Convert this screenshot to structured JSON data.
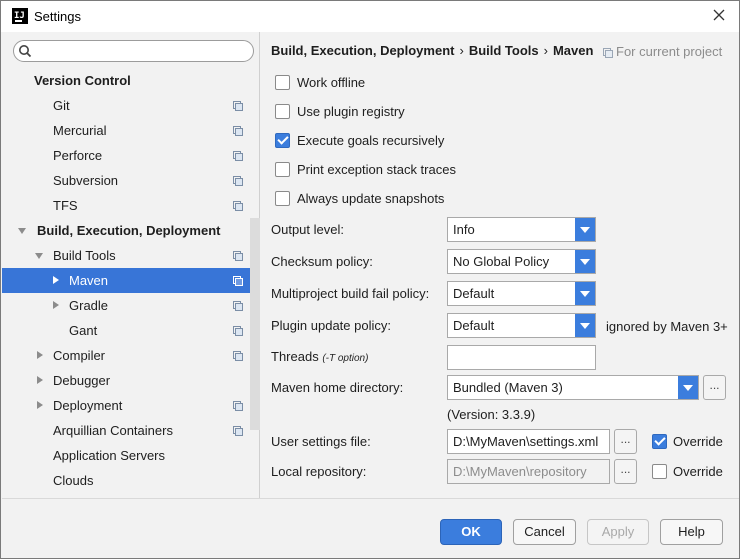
{
  "window": {
    "title": "Settings",
    "app_icon_text": "IJ"
  },
  "search": {
    "placeholder": "",
    "value": ""
  },
  "sidebar": {
    "items": [
      {
        "label": "Version Control"
      },
      {
        "label": "Git"
      },
      {
        "label": "Mercurial"
      },
      {
        "label": "Perforce"
      },
      {
        "label": "Subversion"
      },
      {
        "label": "TFS"
      },
      {
        "label": "Build, Execution, Deployment"
      },
      {
        "label": "Build Tools"
      },
      {
        "label": "Maven"
      },
      {
        "label": "Gradle"
      },
      {
        "label": "Gant"
      },
      {
        "label": "Compiler"
      },
      {
        "label": "Debugger"
      },
      {
        "label": "Deployment"
      },
      {
        "label": "Arquillian Containers"
      },
      {
        "label": "Application Servers"
      },
      {
        "label": "Clouds"
      }
    ],
    "selected": "Maven"
  },
  "breadcrumb": {
    "parts": [
      "Build, Execution, Deployment",
      "Build Tools",
      "Maven"
    ],
    "separator": "›",
    "scope_label": "For current project"
  },
  "checkboxes": [
    {
      "label": "Work offline",
      "checked": false
    },
    {
      "label": "Use plugin registry",
      "checked": false
    },
    {
      "label": "Execute goals recursively",
      "checked": true
    },
    {
      "label": "Print exception stack traces",
      "checked": false
    },
    {
      "label": "Always update snapshots",
      "checked": false
    }
  ],
  "form": {
    "output_level": {
      "label": "Output level:",
      "value": "Info"
    },
    "checksum_policy": {
      "label": "Checksum policy:",
      "value": "No Global Policy"
    },
    "multiproject_fail_policy": {
      "label": "Multiproject build fail policy:",
      "value": "Default"
    },
    "plugin_update_policy": {
      "label": "Plugin update policy:",
      "value": "Default",
      "note": "ignored by Maven 3+"
    },
    "threads": {
      "label": "Threads",
      "hint": "(-T option)",
      "value": ""
    },
    "maven_home": {
      "label": "Maven home directory:",
      "value": "Bundled (Maven 3)",
      "version": "(Version: 3.3.9)",
      "browse": "..."
    },
    "user_settings": {
      "label": "User settings file:",
      "value": "D:\\MyMaven\\settings.xml",
      "browse": "...",
      "override_label": "Override",
      "override_checked": true
    },
    "local_repository": {
      "label": "Local repository:",
      "value": "D:\\MyMaven\\repository",
      "browse": "...",
      "override_label": "Override",
      "override_checked": false
    }
  },
  "buttons": {
    "ok": "OK",
    "cancel": "Cancel",
    "apply": "Apply",
    "help": "Help"
  },
  "colors": {
    "accent": "#3b7ddd",
    "selection": "#3875d7",
    "muted": "#8c8c8c"
  }
}
